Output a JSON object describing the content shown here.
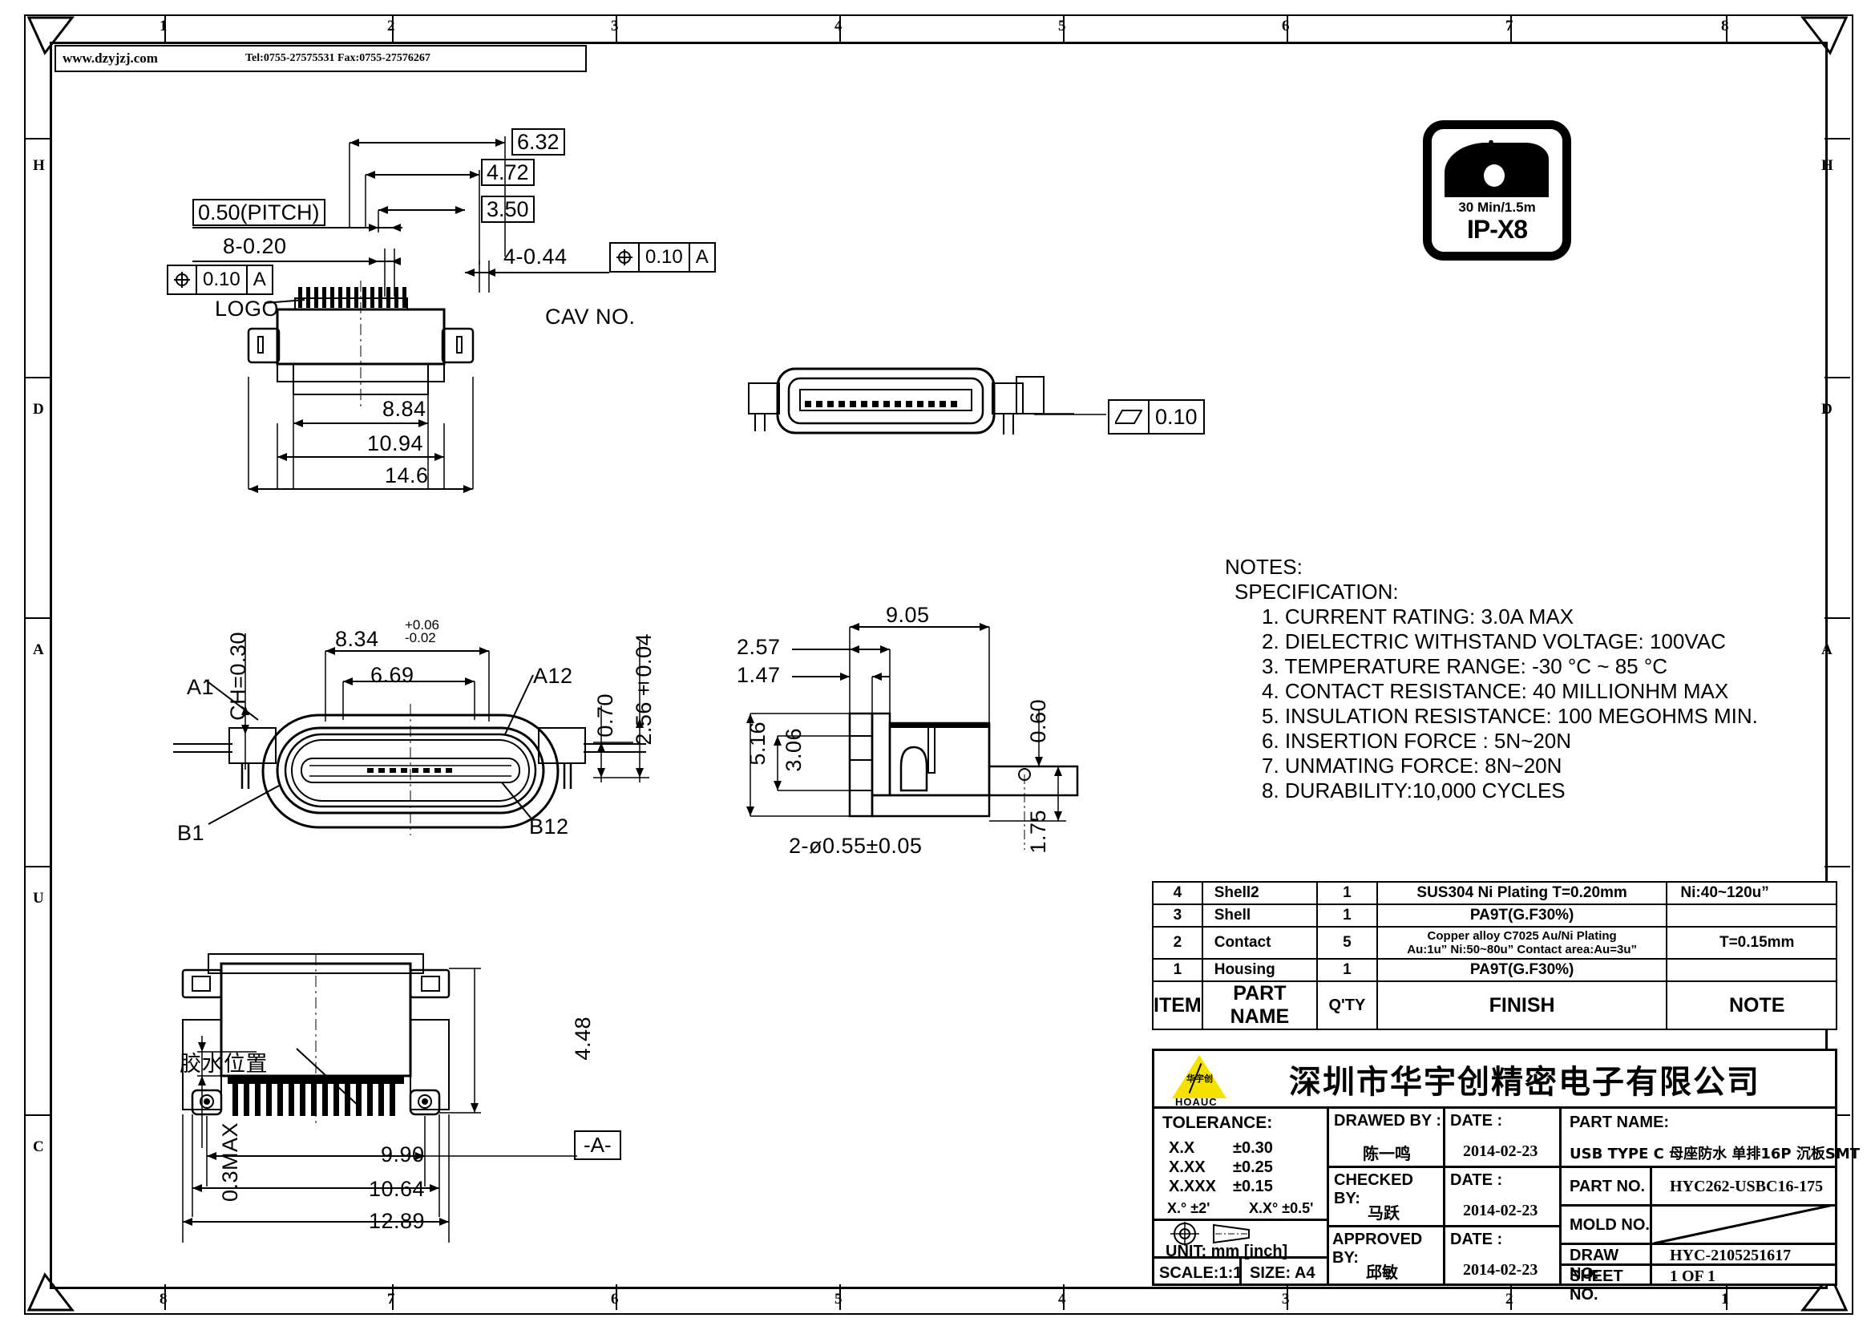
{
  "sheet": {
    "header_url": "www.dzyjzj.com",
    "header_contact": "Tel:0755-27575531  Fax:0755-27576267",
    "zone_numbers_top": [
      "1",
      "2",
      "3",
      "4",
      "5",
      "6",
      "7",
      "8"
    ],
    "zone_numbers_bottom": [
      "8",
      "7",
      "6",
      "5",
      "4",
      "3",
      "2",
      "1"
    ],
    "zone_letters_left": [
      "H",
      "D",
      "A",
      "U",
      "C"
    ],
    "zone_letters_right": [
      "H",
      "D",
      "A",
      "U",
      "C"
    ]
  },
  "ip_badge": {
    "duration": "30 Min/1.5m",
    "rating": "IP-X8"
  },
  "top_view": {
    "labels": {
      "logo": "LOGO",
      "cav": "CAV  NO."
    },
    "boxed_dims": [
      "6.32",
      "4.72",
      "3.50"
    ],
    "pitch": "0.50(PITCH)",
    "holes_left": "8-0.20",
    "holes_right": "4-0.44",
    "fcf_left": {
      "symbol": "position-icon",
      "tol": "0.10",
      "datum": "A"
    },
    "fcf_right": {
      "symbol": "position-icon",
      "tol": "0.10",
      "datum": "A"
    },
    "width_dims": [
      "8.84",
      "10.94",
      "14.6"
    ]
  },
  "side_view_top": {
    "fcf": {
      "symbol": "parallelogram-icon",
      "tol": "0.10"
    }
  },
  "front_view": {
    "ch": "CH=0.30",
    "width_tol": {
      "nominal": "8.34",
      "plus": "+0.06",
      "minus": "-0.02"
    },
    "opening": "6.69",
    "pin_first_top": "A1",
    "pin_last_top": "A12",
    "pin_first_bot": "B1",
    "pin_last_bot": "B12",
    "height_small": "0.70",
    "height_total": "2.56±0.04"
  },
  "section_view": {
    "length": "9.05",
    "dim_a": "2.57",
    "dim_b": "1.47",
    "height_a": "5.16",
    "height_b": "3.06",
    "lead_thk": "0.60",
    "standoff": "1.75",
    "holes": "2-ø0.55±0.05"
  },
  "bottom_view": {
    "glue_note": "胶水位置",
    "max_coplanarity": "0.3MAX",
    "tail_len": "4.48",
    "widths": [
      "9.90",
      "10.64",
      "12.89"
    ],
    "datum": "-A-"
  },
  "notes": {
    "title": "NOTES:",
    "subtitle": "SPECIFICATION:",
    "items": [
      "1.  CURRENT RATING: 3.0A MAX",
      "2.  DIELECTRIC WITHSTAND VOLTAGE: 100VAC",
      "3.  TEMPERATURE RANGE: -30 °C ~ 85 °C",
      "4.  CONTACT RESISTANCE: 40 MILLIONHM MAX",
      "5.  INSULATION RESISTANCE: 100 MEGOHMS MIN.",
      "6.  INSERTION  FORCE  :  5N~20N",
      "7.  UNMATING  FORCE:  8N~20N",
      "8.  DURABILITY:10,000  CYCLES"
    ]
  },
  "bom": {
    "headers": {
      "item": "ITEM",
      "part_name": "PART NAME",
      "qty": "Q'TY",
      "finish": "FINISH",
      "note": "NOTE"
    },
    "rows": [
      {
        "item": "4",
        "part_name": "Shell2",
        "qty": "1",
        "finish": "SUS304  Ni  Plating  T=0.20mm",
        "finish2": "",
        "note": "Ni:40~120u”"
      },
      {
        "item": "3",
        "part_name": "Shell",
        "qty": "1",
        "finish": "PA9T(G.F30%)",
        "finish2": "",
        "note": ""
      },
      {
        "item": "2",
        "part_name": "Contact",
        "qty": "5",
        "finish": "Copper alloy C7025 Au/Ni Plating",
        "finish2": "Au:1u”  Ni:50~80u”  Contact area:Au=3u”",
        "note": "T=0.15mm"
      },
      {
        "item": "1",
        "part_name": "Housing",
        "qty": "1",
        "finish": "PA9T(G.F30%)",
        "finish2": "",
        "note": ""
      }
    ]
  },
  "title_block": {
    "company": "深圳市华宇创精密电子有限公司",
    "logo_text": "HOAUC",
    "logo_inner": "华宇创",
    "tolerance": {
      "title": "TOLERANCE:",
      "l1_key": "X.X",
      "l1_val": "±0.30",
      "l2_key": "X.XX",
      "l2_val": "±0.25",
      "l3_key": "X.XXX",
      "l3_val": "±0.15",
      "l4_key": "X.°  ±2'",
      "l4_val": "X.X°  ±0.5'"
    },
    "unit": "UNIT:  mm  [inch]",
    "scale": "SCALE:1:1",
    "size": "SIZE: A4",
    "drawed_by_label": "DRAWED BY :",
    "drawed_by": "陈一鸣",
    "drawed_date_label": "DATE :",
    "drawed_date": "2014-02-23",
    "checked_by_label": "CHECKED BY:",
    "checked_by": "马跃",
    "checked_date_label": "DATE :",
    "checked_date": "2014-02-23",
    "approved_by_label": "APPROVED BY:",
    "approved_by": "邱敏",
    "approved_date_label": "DATE :",
    "approved_date": "2014-02-23",
    "part_name_label": "PART NAME:",
    "part_name": "USB TYPE C 母座防水 单排16P 沉板SMT",
    "part_no_label": "PART NO.",
    "part_no": "HYC262-USBC16-175",
    "mold_no_label": "MOLD NO.",
    "mold_no": "",
    "draw_no_label": "DRAW NO:",
    "draw_no": "HYC-2105251617",
    "sheet_no_label": "SHEET NO.",
    "sheet_no": "1 OF 1"
  }
}
